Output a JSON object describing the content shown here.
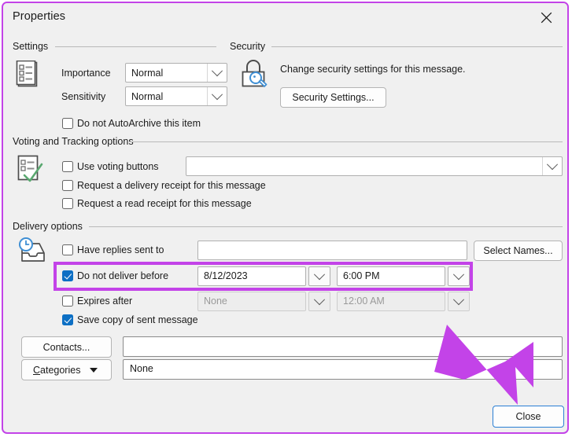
{
  "window": {
    "title": "Properties",
    "close_icon": "close-icon",
    "accent_highlight": "#c343e8",
    "checkbox_accent": "#0d6fc4",
    "focus_border": "#2a7fd4"
  },
  "settings": {
    "group_label": "Settings",
    "icon": "settings-list-icon",
    "importance_label": "Importance",
    "importance_value": "Normal",
    "sensitivity_label": "Sensitivity",
    "sensitivity_value": "Normal",
    "autoarchive_label": "Do not AutoArchive this item",
    "autoarchive_checked": false
  },
  "security": {
    "group_label": "Security",
    "icon": "lock-magnifier-icon",
    "description": "Change security settings for this message.",
    "button_label": "Security Settings..."
  },
  "voting": {
    "group_label": "Voting and Tracking options",
    "icon": "ballot-check-icon",
    "use_voting_label": "Use voting buttons",
    "use_voting_checked": false,
    "voting_value": "",
    "delivery_receipt_label": "Request a delivery receipt for this message",
    "delivery_receipt_checked": false,
    "read_receipt_label": "Request a read receipt for this message",
    "read_receipt_checked": false
  },
  "delivery": {
    "group_label": "Delivery options",
    "icon": "inbox-clock-icon",
    "have_replies_label": "Have replies sent to",
    "have_replies_checked": false,
    "have_replies_value": "",
    "select_names_label": "Select Names...",
    "do_not_deliver_label": "Do not deliver before",
    "do_not_deliver_checked": true,
    "do_not_deliver_date": "8/12/2023",
    "do_not_deliver_time": "6:00 PM",
    "expires_after_label": "Expires after",
    "expires_after_checked": false,
    "expires_after_date": "None",
    "expires_after_time": "12:00 AM",
    "save_copy_label": "Save copy of sent message",
    "save_copy_checked": true
  },
  "bottom": {
    "contacts_label": "Contacts...",
    "contacts_value": "",
    "categories_label": "Categories",
    "categories_value": "None",
    "close_label": "Close"
  }
}
